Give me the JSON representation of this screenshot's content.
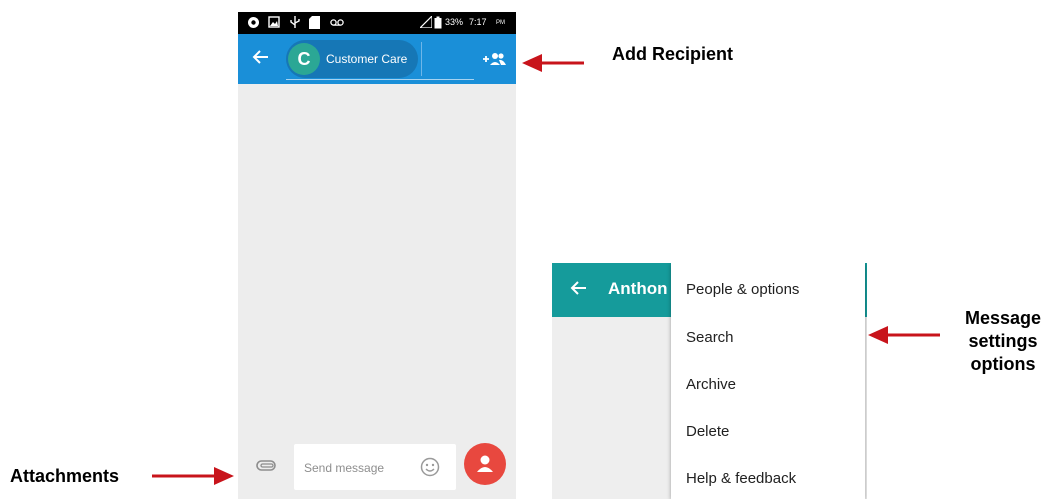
{
  "phone1": {
    "status": {
      "battery": "33%",
      "time": "7:17",
      "ampm": "PM"
    },
    "recipient": {
      "initial": "C",
      "name": "Customer Care"
    },
    "composer": {
      "placeholder": "Send message"
    },
    "icons": [
      "back-arrow-icon",
      "add-recipient-icon",
      "attachment-icon",
      "emoji-icon",
      "contact-icon"
    ],
    "colors": {
      "appbar": "#1a8fd8",
      "avatar": "#2ba795",
      "fab": "#e8483f"
    }
  },
  "phone2": {
    "title": "Anthon",
    "menu": [
      "People & options",
      "Search",
      "Archive",
      "Delete",
      "Help & feedback"
    ],
    "colors": {
      "appbar": "#159b9b"
    }
  },
  "annotations": {
    "add_recipient": "Add Recipient",
    "attachments": "Attachments",
    "message_settings": [
      "Message",
      "settings",
      "options"
    ],
    "arrow_color": "#c8141b"
  }
}
